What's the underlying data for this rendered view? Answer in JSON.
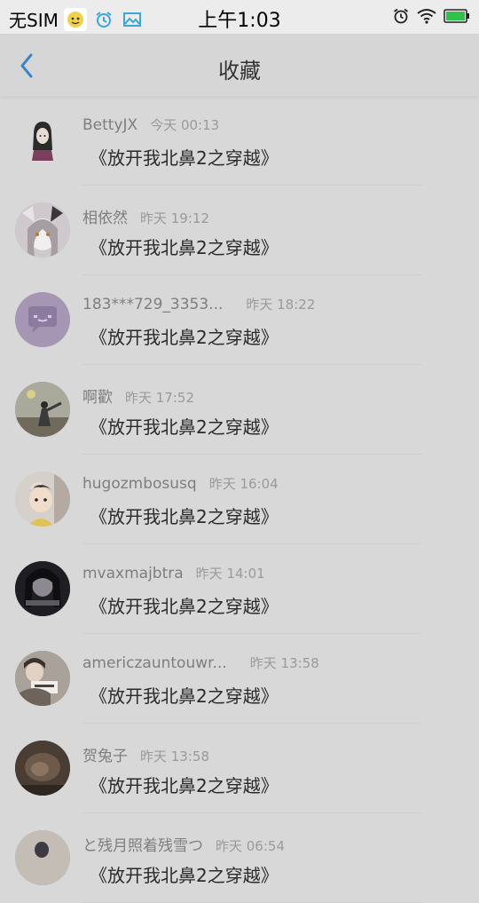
{
  "status_bar": {
    "carrier": "无SIM",
    "time": "上午1:03"
  },
  "header": {
    "title": "收藏"
  },
  "items": [
    {
      "name": "BettyJX",
      "time": "今天 00:13",
      "title": "《放开我北鼻2之穿越》",
      "avatar_color": "#d5d5d5"
    },
    {
      "name": "相依然",
      "time": "昨天 19:12",
      "title": "《放开我北鼻2之穿越》",
      "avatar_color": "#b9b1b5"
    },
    {
      "name": "183***729_3353...",
      "time": "昨天 18:22",
      "title": "《放开我北鼻2之穿越》",
      "avatar_color": "#a596b4"
    },
    {
      "name": "啊歡",
      "time": "昨天 17:52",
      "title": "《放开我北鼻2之穿越》",
      "avatar_color": "#8a8a80"
    },
    {
      "name": "hugozmbosusq",
      "time": "昨天 16:04",
      "title": "《放开我北鼻2之穿越》",
      "avatar_color": "#c7bfb8"
    },
    {
      "name": "mvaxmajbtra",
      "time": "昨天 14:01",
      "title": "《放开我北鼻2之穿越》",
      "avatar_color": "#2e2e32"
    },
    {
      "name": "americzauntouwr...",
      "time": "昨天 13:58",
      "title": "《放开我北鼻2之穿越》",
      "avatar_color": "#8f8a84"
    },
    {
      "name": "贺兔子",
      "time": "昨天 13:58",
      "title": "《放开我北鼻2之穿越》",
      "avatar_color": "#55463c"
    },
    {
      "name": "と残月照着残雪つ",
      "time": "昨天 06:54",
      "title": "《放开我北鼻2之穿越》",
      "avatar_color": "#b0aaa4"
    }
  ]
}
